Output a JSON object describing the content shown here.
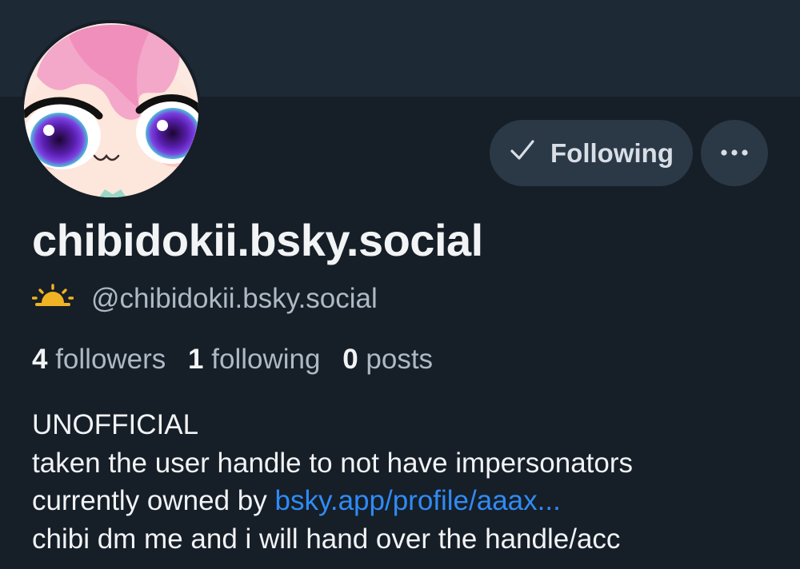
{
  "profile": {
    "display_name": "chibidokii.bsky.social",
    "handle": "@chibidokii.bsky.social",
    "handle_icon": "sun-icon"
  },
  "actions": {
    "following_label": "Following",
    "following_icon": "checkmark-icon",
    "more_icon": "ellipsis-icon"
  },
  "stats": {
    "followers_count": "4",
    "followers_label": "followers",
    "following_count": "1",
    "following_label": "following",
    "posts_count": "0",
    "posts_label": "posts"
  },
  "bio": {
    "line1": "UNOFFICIAL",
    "line2": "taken the user handle to not have impersonators",
    "line3_prefix": "currently owned by ",
    "line3_link": "bsky.app/profile/aaax...",
    "line4": "chibi dm me and i will hand over the handle/acc"
  },
  "colors": {
    "background": "#161e27",
    "banner": "#1e2936",
    "button": "#2b3846",
    "link": "#2f8bf5",
    "secondary_text": "#aeb9c6",
    "sun_icon": "#f0b323"
  }
}
